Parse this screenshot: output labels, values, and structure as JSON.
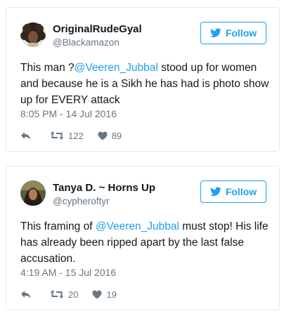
{
  "tweets": [
    {
      "name": "OriginalRudeGyal",
      "handle": "@Blackamazon",
      "follow_label": "Follow",
      "text_before": "This man ?",
      "mention": "@Veeren_Jubbal",
      "text_after": " stood up for women and because he is a Sikh he has had is photo show up for EVERY attack",
      "timestamp": "8:05 PM - 14 Jul 2016",
      "retweets": "122",
      "likes": "89",
      "avatar_icon": "avatar-curly-hair"
    },
    {
      "name": "Tanya D. ~ Horns Up",
      "handle": "@cypheroftyr",
      "follow_label": "Follow",
      "text_before": "This framing of ",
      "mention": "@Veeren_Jubbal",
      "text_after": " must stop! His life has already been ripped apart by the last false accusation.",
      "timestamp": "4:19 AM - 15 Jul 2016",
      "retweets": "20",
      "likes": "19",
      "avatar_icon": "avatar-photo"
    }
  ],
  "colors": {
    "accent": "#1da1f2",
    "text": "#14171a",
    "muted": "#657786",
    "border": "#e1e8ed"
  }
}
